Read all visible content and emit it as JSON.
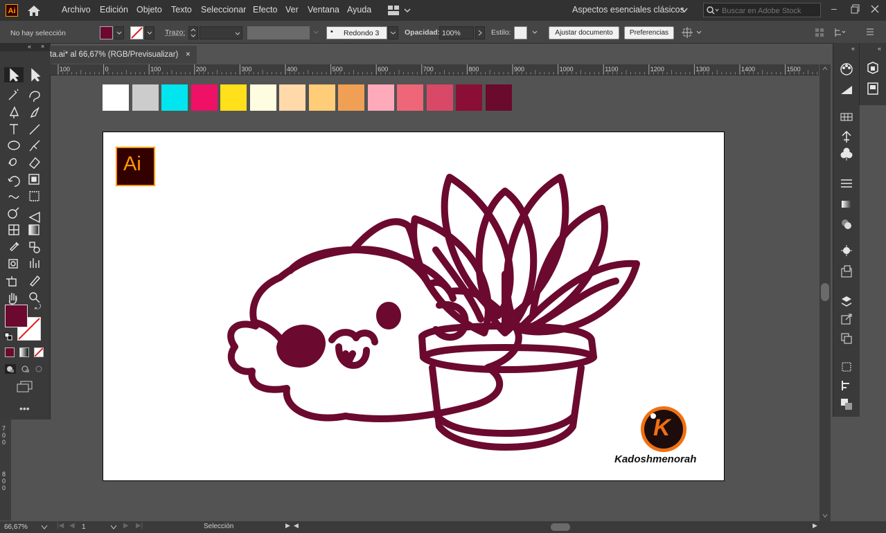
{
  "app": {
    "logo_text": "Ai"
  },
  "menu": [
    "Archivo",
    "Edición",
    "Objeto",
    "Texto",
    "Seleccionar",
    "Efecto",
    "Ver",
    "Ventana",
    "Ayuda"
  ],
  "workspace": {
    "label": "Aspectos esenciales clásicos"
  },
  "search": {
    "placeholder": "Buscar en Adobe Stock"
  },
  "control": {
    "selection_status": "No hay selección",
    "stroke_label": "Trazo:",
    "brush_value": "Redondo 3 ...",
    "opacity_label": "Opacidad:",
    "opacity_value": "100%",
    "style_label": "Estilo:",
    "adjust_button": "Ajustar documento",
    "prefs_button": "Preferencias"
  },
  "document": {
    "tab_title": "ta.ai* al 66,67% (RGB/Previsualizar)",
    "close": "×"
  },
  "ruler": {
    "ticks": [
      "100",
      "0",
      "100",
      "200",
      "300",
      "400",
      "500",
      "600",
      "700",
      "800",
      "900",
      "1000",
      "1100",
      "1200",
      "1300",
      "1400",
      "1500"
    ]
  },
  "vruler": {
    "ticks": [
      "7",
      "0",
      "0",
      "8",
      "0",
      "0"
    ]
  },
  "colors": {
    "fill": "#6b0a2e",
    "accent": "#ff9a00",
    "stroke_art": "#6b0a2e",
    "swatches": [
      "#ffffff",
      "#cccccc",
      "#00e5ee",
      "#ee1166",
      "#ffe01a",
      "#fffde0",
      "#ffd9aa",
      "#ffcc77",
      "#f0a055",
      "#ffaabb",
      "#ee6677",
      "#d94866",
      "#8a0e35",
      "#6a0a2c"
    ]
  },
  "artboard": {
    "ai_badge": "Ai",
    "watermark_text": "Kadoshmenorah",
    "watermark_letter": "K"
  },
  "status": {
    "zoom": "66,67%",
    "page": "1",
    "tool": "Selección"
  },
  "icons": {
    "tools": [
      "selection-icon",
      "direct-selection-icon",
      "magic-wand-icon",
      "lasso-icon",
      "pen-icon",
      "curvature-icon",
      "type-icon",
      "line-icon",
      "ellipse-icon",
      "paintbrush-icon",
      "shaper-icon",
      "eraser-icon",
      "rotate-icon",
      "scale-icon",
      "warp-icon",
      "free-transform-icon",
      "shape-builder-icon",
      "perspective-icon",
      "mesh-icon",
      "gradient-icon",
      "eyedropper-icon",
      "blend-icon",
      "symbol-sprayer-icon",
      "graph-icon",
      "artboard-icon",
      "slice-icon",
      "hand-icon",
      "zoom-icon"
    ]
  }
}
